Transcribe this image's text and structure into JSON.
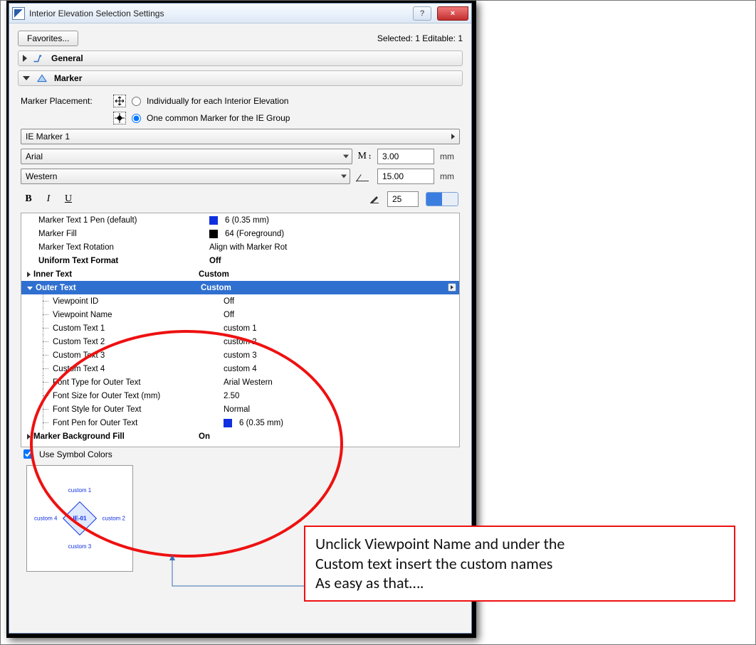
{
  "window": {
    "title": "Interior Elevation Selection Settings",
    "help": "?",
    "close": "×"
  },
  "header": {
    "favorites": "Favorites...",
    "status": "Selected: 1 Editable: 1"
  },
  "panels": {
    "general": "General",
    "marker": "Marker"
  },
  "placement": {
    "label": "Marker Placement:",
    "opt_individual": "Individually for each Interior Elevation",
    "opt_common": "One common Marker for the IE Group"
  },
  "marker_select": "IE Marker 1",
  "use_symbol_colors": "Use Symbol Colors",
  "font": {
    "family": "Arial",
    "script": "Western"
  },
  "sizes": {
    "m_height": "3.00",
    "angle": "15.00",
    "mm": "mm"
  },
  "pen_value": "25",
  "tree": {
    "pen_default": {
      "label": "Marker Text 1 Pen (default)",
      "value": "6 (0.35 mm)",
      "swatch": "#1030e0"
    },
    "fill": {
      "label": "Marker Fill",
      "value": "64 (Foreground)",
      "swatch": "#000000"
    },
    "rotation": {
      "label": "Marker Text Rotation",
      "value": "Align with Marker Rot"
    },
    "uniform": {
      "label": "Uniform Text Format",
      "value": "Off"
    },
    "inner": {
      "label": "Inner Text",
      "value": "Custom"
    },
    "outer": {
      "label": "Outer Text",
      "value": "Custom"
    },
    "children": {
      "vp_id": {
        "label": "Viewpoint ID",
        "value": "Off"
      },
      "vp_name": {
        "label": "Viewpoint Name",
        "value": "Off"
      },
      "c1": {
        "label": "Custom Text 1",
        "value": "custom 1"
      },
      "c2": {
        "label": "Custom Text 2",
        "value": "custom 2"
      },
      "c3": {
        "label": "Custom Text 3",
        "value": "custom 3"
      },
      "c4": {
        "label": "Custom Text 4",
        "value": "custom 4"
      },
      "ftype": {
        "label": "Font Type for Outer Text",
        "value": "Arial Western"
      },
      "fsize": {
        "label": "Font Size for Outer Text (mm)",
        "value": "2.50"
      },
      "fstyle": {
        "label": "Font Style for Outer Text",
        "value": "Normal"
      },
      "fpen": {
        "label": "Font Pen for Outer Text",
        "value": "6 (0.35 mm)",
        "swatch": "#1030e0"
      }
    },
    "bgfill": {
      "label": "Marker Background Fill",
      "value": "On"
    }
  },
  "preview": {
    "center": "IE-01",
    "top": "custom 1",
    "right": "custom 2",
    "bottom": "custom 3",
    "left": "custom 4"
  },
  "callout": {
    "line1": "Unclick Viewpoint Name and under the",
    "line2": "Custom text insert the custom names",
    "line3": "As easy as that…."
  }
}
